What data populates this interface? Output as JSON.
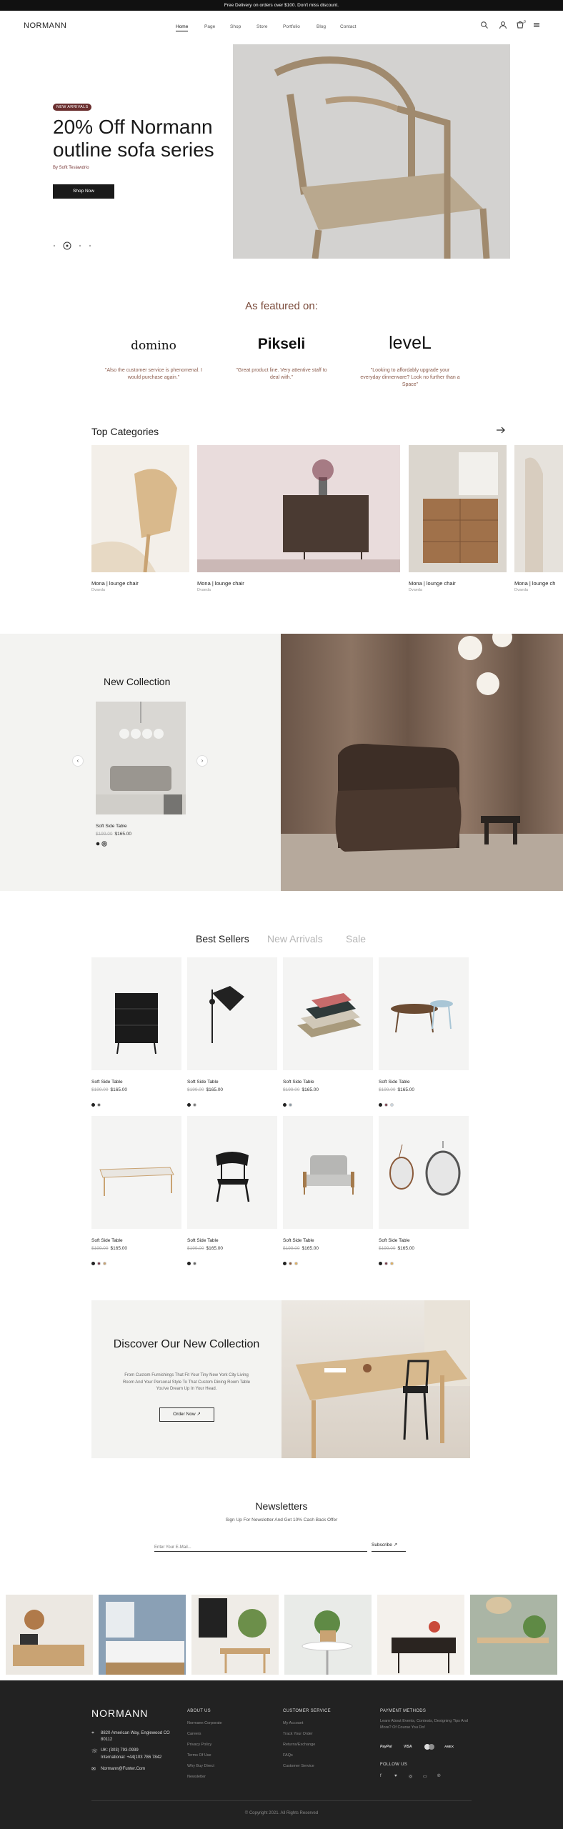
{
  "topbar": {
    "text": "Free Delivery on orders over $100. Don't miss discount."
  },
  "header": {
    "logo": "NORMANN",
    "menu": [
      "Home",
      "Page",
      "Shop",
      "Store",
      "Portfolio",
      "Blog",
      "Contact"
    ],
    "cart_count": "0"
  },
  "hero": {
    "badge": "NEW ARRIVALS",
    "title": "20% Off Normann outline sofa series",
    "byline": "By Sofit Teslawdrio",
    "button": "Shop Now"
  },
  "featured": {
    "title": "As featured on:",
    "items": [
      {
        "logo": "domino",
        "quote": "\"Also the customer service is phenomenal. I would purchase again.\""
      },
      {
        "logo": "Pikseli",
        "quote": "\"Great product line. Very attentive staff to deal with.\""
      },
      {
        "logo": "leveL",
        "quote": "\"Looking to affordably upgrade your everyday dinnerware? Look no further than a Space\""
      }
    ]
  },
  "categories": {
    "title": "Top Categories",
    "items": [
      {
        "title": "Mona | lounge chair",
        "sub": "Dvaeda"
      },
      {
        "title": "Mona | lounge chair",
        "sub": "Dvaeda"
      },
      {
        "title": "Mona | lounge chair",
        "sub": "Dvaeda"
      },
      {
        "title": "Mona | lounge ch",
        "sub": "Dvaeda"
      }
    ]
  },
  "new_collection": {
    "title": "New Collection",
    "product": "Soft Side Table",
    "old_price": "$199.00",
    "price": "$165.00"
  },
  "best": {
    "tabs": [
      "Best Sellers",
      "New Arrivals",
      "Sale"
    ],
    "products": [
      {
        "title": "Soft Side Table",
        "old": "$199.00",
        "price": "$165.00"
      },
      {
        "title": "Soft Side Table",
        "old": "$199.00",
        "price": "$165.00"
      },
      {
        "title": "Soft Side Table",
        "old": "$199.00",
        "price": "$165.00"
      },
      {
        "title": "Soft Side Table",
        "old": "$199.00",
        "price": "$165.00"
      },
      {
        "title": "Soft Side Table",
        "old": "$199.00",
        "price": "$165.00"
      },
      {
        "title": "Soft Side Table",
        "old": "$199.00",
        "price": "$165.00"
      },
      {
        "title": "Soft Side Table",
        "old": "$199.00",
        "price": "$165.00"
      },
      {
        "title": "Soft Side Table",
        "old": "$199.00",
        "price": "$165.00"
      }
    ]
  },
  "discover": {
    "title": "Discover Our New Collection",
    "text": "From Custom Furnishings That Fit Your Tiny New York City Living Room And Your Personal Style To That Custom Dining Room Table You've Dream Up In Your Head.",
    "button": "Order Now"
  },
  "newsletter": {
    "title": "Newsletters",
    "sub": "Sign Up For Newsletter And Get 10% Cash Back Offer",
    "placeholder": "Enter Your E-Mail...",
    "button": "Subscribe"
  },
  "footer": {
    "logo": "NORMANN",
    "address": "8820 American Way, Englewood CO 80112",
    "phone1": "UK: (303) 793-0939",
    "phone2": "International: +44(103 786 7842",
    "email": "Normann@Funter.Com",
    "about_head": "ABOUT US",
    "about": [
      "Normann Corporate",
      "Careers",
      "Privacy Policy",
      "Terms Of Use",
      "Why Buy Direct",
      "Newsletter"
    ],
    "cs_head": "CUSTOMER SERVICE",
    "cs": [
      "My Account",
      "Track Your Order",
      "Returns/Exchange",
      "FAQs",
      "Customer Service"
    ],
    "pay_head": "PAYMENT METHODS",
    "pay_text": "Learn About Events, Contests, Designing Tips And More? Of Course You Do!",
    "pay": [
      "PayPal",
      "VISA",
      "Mastercard",
      "AMEX"
    ],
    "follow_head": "FOLLOW US",
    "copyright": "© Copyright 2021. All Rights Reserved"
  }
}
